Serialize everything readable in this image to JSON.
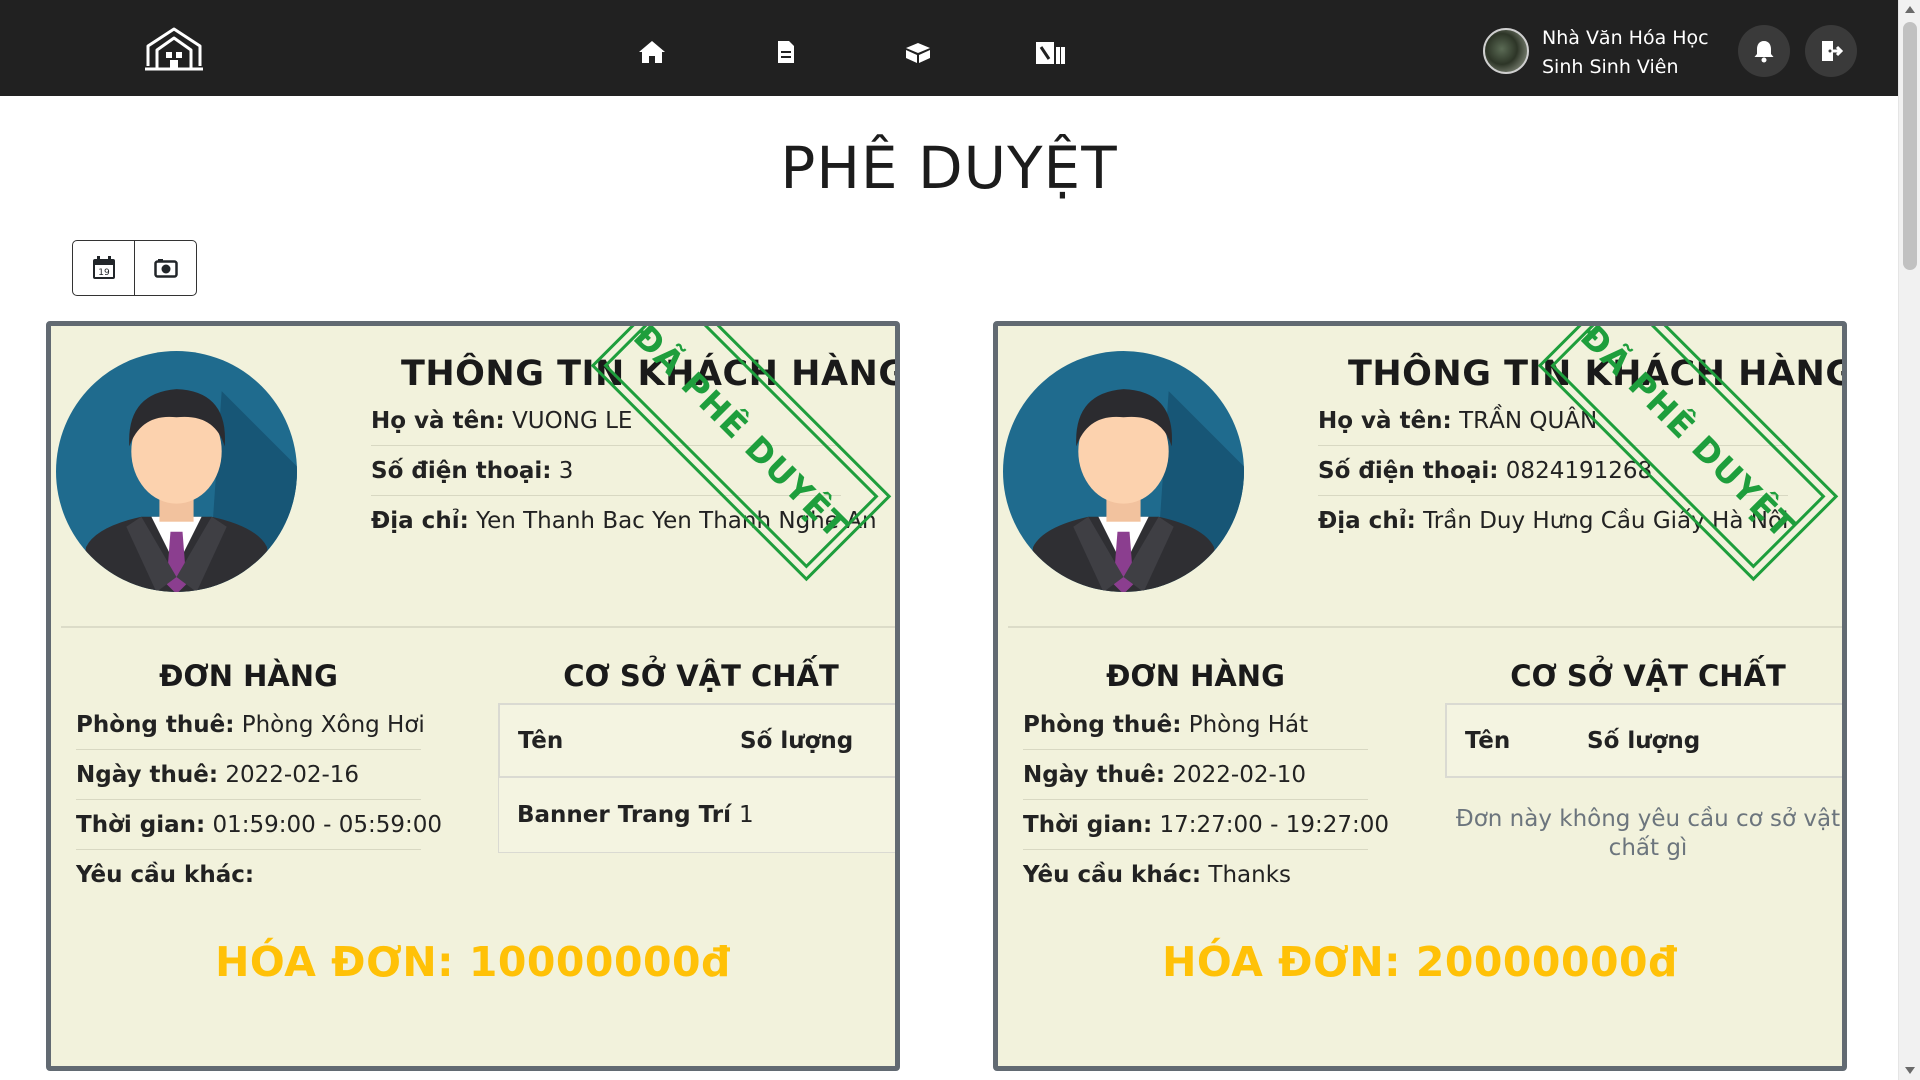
{
  "header": {
    "logo_icon": "house-logo-icon",
    "nav_icons": [
      "home-icon",
      "document-icon",
      "box-icon",
      "building-icon"
    ],
    "user_name": "Nhà Văn Hóa Học Sinh Sinh Viên",
    "bell_icon": "bell-icon",
    "logout_icon": "logout-icon"
  },
  "page_title": "PHÊ DUYỆT",
  "tools": [
    "calendar-icon",
    "camera-icon"
  ],
  "calendar_day": "19",
  "labels": {
    "customer_title": "THÔNG TIN KHÁCH HÀNG",
    "name": "Họ và tên:",
    "phone": "Số điện thoại:",
    "address": "Địa chỉ:",
    "order_title": "ĐƠN HÀNG",
    "room": "Phòng thuê:",
    "date": "Ngày thuê:",
    "time": "Thời gian:",
    "other": "Yêu cầu khác:",
    "facility_title": "CƠ SỞ VẬT CHẤT",
    "col_name": "Tên",
    "col_qty": "Số lượng",
    "no_facility": "Đơn này không yêu cầu cơ sở vật chất gì",
    "stamp": "ĐÃ PHÊ DUYỆT",
    "invoice_prefix": "HÓA ĐƠN:"
  },
  "cards": [
    {
      "name": "VUONG LE",
      "phone": "3",
      "address": "Yen Thanh Bac Yen Thanh Nghe An",
      "room": "Phòng Xông Hơi",
      "date": "2022-02-16",
      "time": "01:59:00 - 05:59:00",
      "other": "",
      "facilities": [
        {
          "name": "Banner Trang Trí",
          "qty": "1"
        }
      ],
      "invoice": "HÓA ĐƠN: 10000000đ"
    },
    {
      "name": "TRẦN QUÂN",
      "phone": "0824191268",
      "address": "Trần Duy Hưng Cầu Giấy Hà Nội",
      "room": "Phòng Hát",
      "date": "2022-02-10",
      "time": "17:27:00 - 19:27:00",
      "other": "Thanks",
      "facilities": [],
      "invoice": "HÓA ĐƠN: 20000000đ"
    }
  ],
  "colors": {
    "navbar": "#212121",
    "card_bg": "#f2f2dc",
    "card_border": "#626a72",
    "stamp": "#1e9e3c",
    "invoice": "#ffc107",
    "muted": "#6c757d"
  }
}
